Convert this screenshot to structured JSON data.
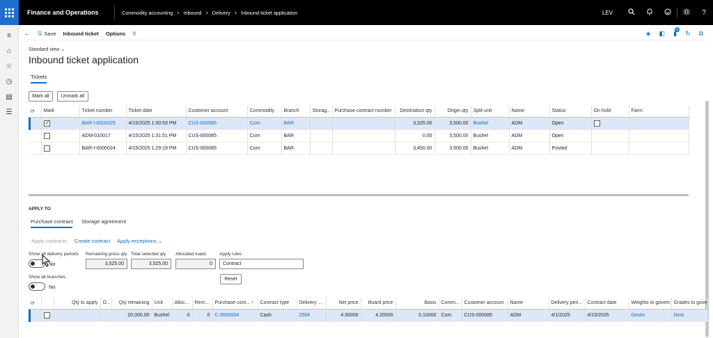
{
  "topbar": {
    "app_name": "Finance and Operations",
    "breadcrumbs": [
      "Commodity accounting",
      "Inbound",
      "Delivery",
      "Inbound ticket application"
    ],
    "user": "LEV",
    "icons": [
      "search-icon",
      "bell-icon",
      "smiley-icon",
      "gear-icon",
      "help-icon"
    ]
  },
  "sidebar": {
    "icons": [
      "hamburger-icon",
      "home-icon",
      "star-icon",
      "clock-icon",
      "workspace-icon",
      "list-icon"
    ]
  },
  "actionbar": {
    "save": "Save",
    "inbound_ticket": "Inbound ticket",
    "options": "Options",
    "notification_count": "0"
  },
  "page": {
    "view": "Standard view",
    "title": "Inbound ticket application",
    "tab": "Tickets",
    "mark_all": "Mark all",
    "unmark_all": "Unmark all"
  },
  "tickets": {
    "headers": [
      "Mark",
      "Ticket number",
      "Ticket date",
      "Customer account",
      "Commodity",
      "Branch",
      "Storag...",
      "Purchase contract number",
      "Destination qty",
      "Origin qty",
      "Split unit",
      "Name",
      "Status",
      "On hold",
      "Farm"
    ],
    "rows": [
      {
        "mark": true,
        "ticket": "BAR-I-0000025",
        "date": "4/15/2025 1:30:53 PM",
        "account": "CUS-000085",
        "commodity": "Corn",
        "branch": "BAR",
        "storage": "",
        "contract": "",
        "dest_qty": "3,525.00",
        "origin_qty": "3,500.00",
        "unit": "Bushel",
        "name": "ADM",
        "status": "Open",
        "on_hold": false,
        "farm": ""
      },
      {
        "mark": false,
        "ticket": "ADM-010017",
        "date": "4/15/2025 1:31:51 PM",
        "account": "CUS-000085",
        "commodity": "Corn",
        "branch": "BAR",
        "storage": "",
        "contract": "",
        "dest_qty": "0.00",
        "origin_qty": "3,500.00",
        "unit": "Bushel",
        "name": "ADM",
        "status": "Open",
        "on_hold": null,
        "farm": ""
      },
      {
        "mark": false,
        "ticket": "BAR-I-0000024",
        "date": "4/15/2025 1:29:19 PM",
        "account": "CUS-000085",
        "commodity": "Corn",
        "branch": "BAR",
        "storage": "",
        "contract": "",
        "dest_qty": "3,450.00",
        "origin_qty": "3,500.00",
        "unit": "Bushel",
        "name": "ADM",
        "status": "Posted",
        "on_hold": null,
        "farm": ""
      }
    ]
  },
  "apply_to": {
    "section": "APPLY TO",
    "tabs": [
      "Purchase contract",
      "Storage agreement"
    ],
    "actions": {
      "apply_contracts": "Apply contracts",
      "create_contract": "Create contract",
      "apply_exceptions": "Apply exceptions"
    },
    "show_delivery_label": "Show all delivery periods",
    "show_delivery_value": "No",
    "remaining_gross_label": "Remaining gross qty",
    "remaining_gross_value": "3,525.00",
    "total_selected_label": "Total selected qty",
    "total_selected_value": "3,525.00",
    "allocated_loads_label": "Allocated loads",
    "allocated_loads_value": "0",
    "apply_rules_label": "Apply rules",
    "apply_rules_value": "Contract",
    "show_branches_label": "Show all branches",
    "show_branches_value": "No",
    "reset": "Reset"
  },
  "contracts": {
    "headers": [
      "Qty to apply",
      "O...",
      "Qty remaining",
      "Unit",
      "Alloc...",
      "Rem...",
      "Purchase cont...",
      "Contract type",
      "Delivery ...",
      "Net price",
      "Board price",
      "Basis",
      "Comm...",
      "Customer account",
      "Name",
      "Delivery peri...",
      "Contract date",
      "Weights to govern",
      "Grades to govern"
    ],
    "rows": [
      {
        "qty_apply": "",
        "o": "",
        "qty_rem": "20,000.00",
        "unit": "Bushel",
        "alloc": "0",
        "rem": "0",
        "contract": "C-0000004",
        "type": "Cash",
        "delivery": "2504",
        "net": "4.30000",
        "board": "4.20000",
        "basis": "0.10000",
        "comm": "Corn",
        "account": "CUS-000085",
        "name": "ADM",
        "period": "4/1/2025",
        "cdate": "4/15/2025",
        "weights": "Destin",
        "grades": "Dest"
      }
    ]
  }
}
